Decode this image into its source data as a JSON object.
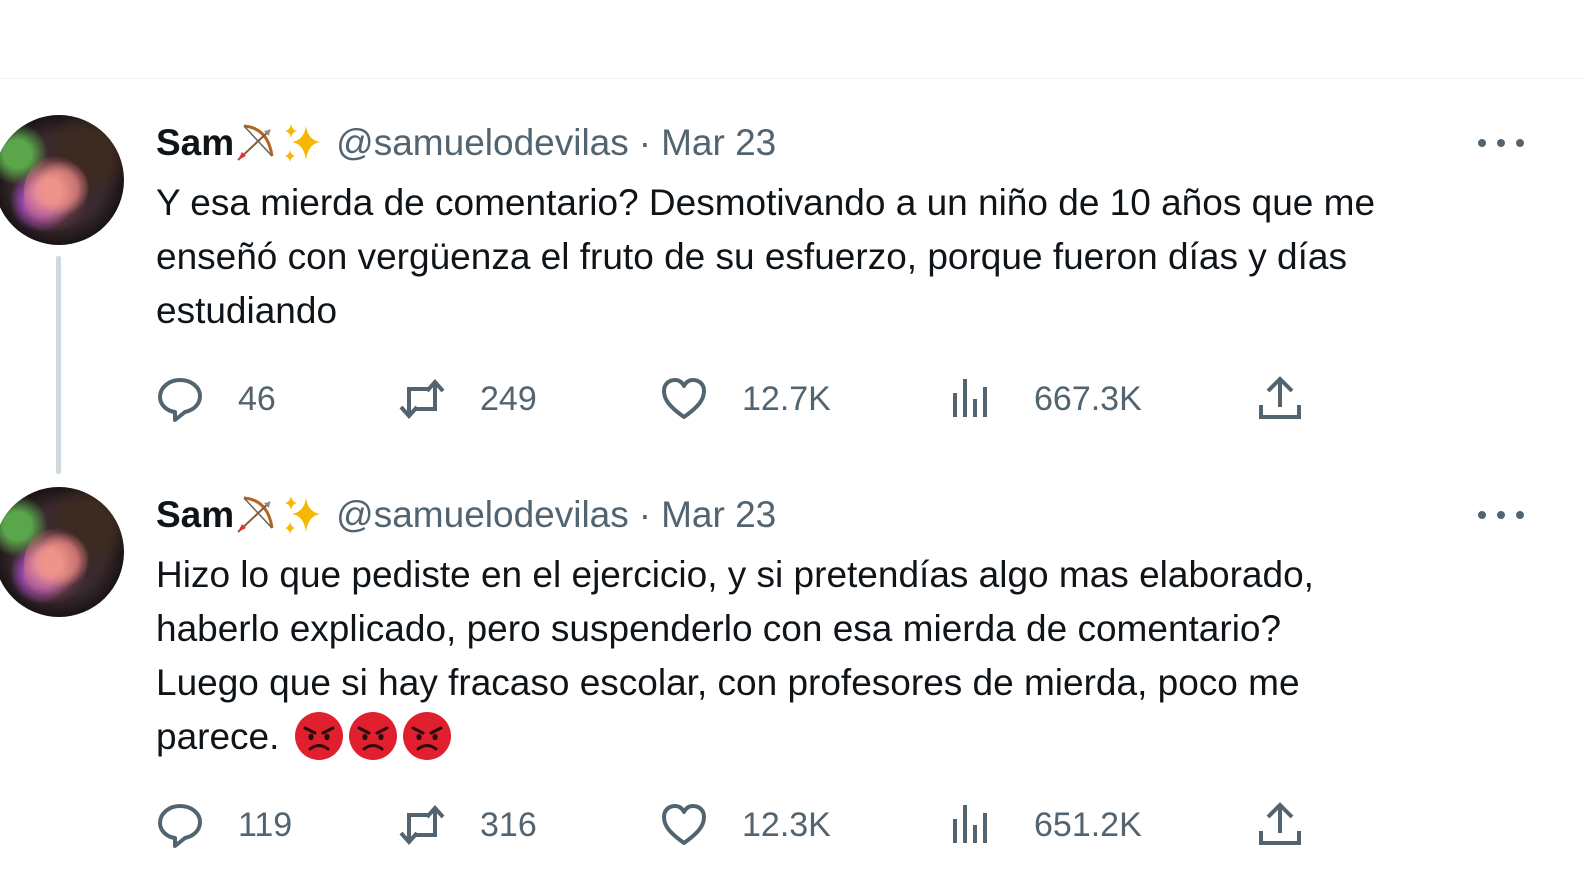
{
  "tweets": [
    {
      "display_name": "Sam",
      "name_emojis": [
        "bow-and-arrow-emoji",
        "sparkles-emoji"
      ],
      "handle": "@samuelodevilas",
      "separator": "·",
      "date": "Mar 23",
      "text_lines": [
        "Y esa mierda de comentario? Desmotivando a un niño de 10 años que me",
        "enseñó con vergüenza el fruto de su esfuerzo, porque fueron días y días",
        "estudiando"
      ],
      "replies": "46",
      "retweets": "249",
      "likes": "12.7K",
      "views": "667.3K"
    },
    {
      "display_name": "Sam",
      "name_emojis": [
        "bow-and-arrow-emoji",
        "sparkles-emoji"
      ],
      "handle": "@samuelodevilas",
      "separator": "·",
      "date": "Mar 23",
      "text_lines": [
        "Hizo lo que pediste en el ejercicio, y si pretendías algo mas elaborado,",
        "haberlo explicado, pero suspenderlo con esa mierda de comentario?",
        "Luego que si hay fracaso escolar, con profesores de mierda, poco me",
        "parece."
      ],
      "trailing_emojis": [
        "angry-face-emoji",
        "angry-face-emoji",
        "angry-face-emoji"
      ],
      "replies": "119",
      "retweets": "316",
      "likes": "12.3K",
      "views": "651.2K"
    }
  ],
  "colors": {
    "text": "#0f1419",
    "secondary": "#536471",
    "divider": "#eff3f4",
    "thread_line": "#cfd9de",
    "angry_emoji": "#e0202e"
  }
}
